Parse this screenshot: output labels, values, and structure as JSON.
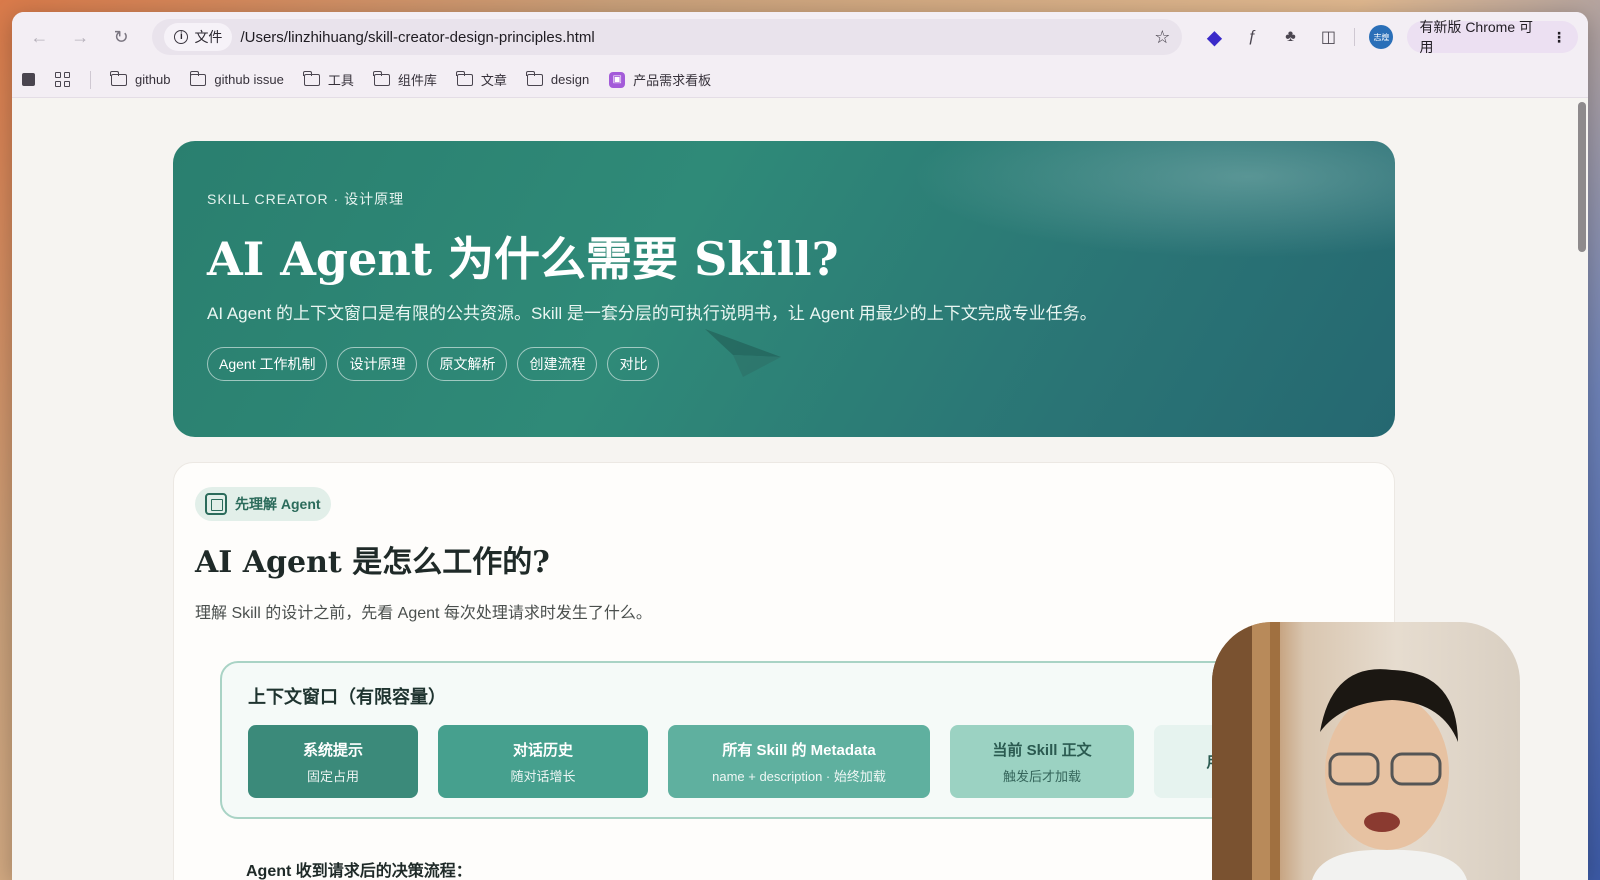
{
  "browser": {
    "file_chip": "文件",
    "url": "/Users/linzhihuang/skill-creator-design-principles.html",
    "avatar_text": "志煌",
    "update_label": "有新版 Chrome 可用"
  },
  "bookmarks": [
    "github",
    "github issue",
    "工具",
    "组件库",
    "文章",
    "design"
  ],
  "bookmark_special": "产品需求看板",
  "hero": {
    "eyebrow": "SKILL CREATOR · 设计原理",
    "title": "AI Agent 为什么需要 Skill?",
    "description": "AI Agent 的上下文窗口是有限的公共资源。Skill 是一套分层的可执行说明书，让 Agent 用最少的上下文完成专业任务。",
    "tags": [
      "Agent 工作机制",
      "设计原理",
      "原文解析",
      "创建流程",
      "对比"
    ]
  },
  "section": {
    "badge": "先理解 Agent",
    "title": "AI Agent 是怎么工作的?",
    "description": "理解 Skill 的设计之前，先看 Agent 每次处理请求时发生了什么。",
    "context_window": {
      "title": "上下文窗口（有限容量）",
      "blocks": [
        {
          "title": "系统提示",
          "subtitle": "固定占用",
          "color": "#3b8a7a"
        },
        {
          "title": "对话历史",
          "subtitle": "随对话增长",
          "color": "#46a08e"
        },
        {
          "title": "所有 Skill 的 Metadata",
          "subtitle": "name + description · 始终加载",
          "color": "#5fb09f"
        },
        {
          "title": "当前 Skill 正文",
          "subtitle": "触发后才加载",
          "color": "#9bd2c2"
        },
        {
          "title": "用",
          "subtitle": "",
          "color": "#e6f3ef"
        }
      ]
    },
    "next_heading": "Agent 收到请求后的决策流程："
  }
}
